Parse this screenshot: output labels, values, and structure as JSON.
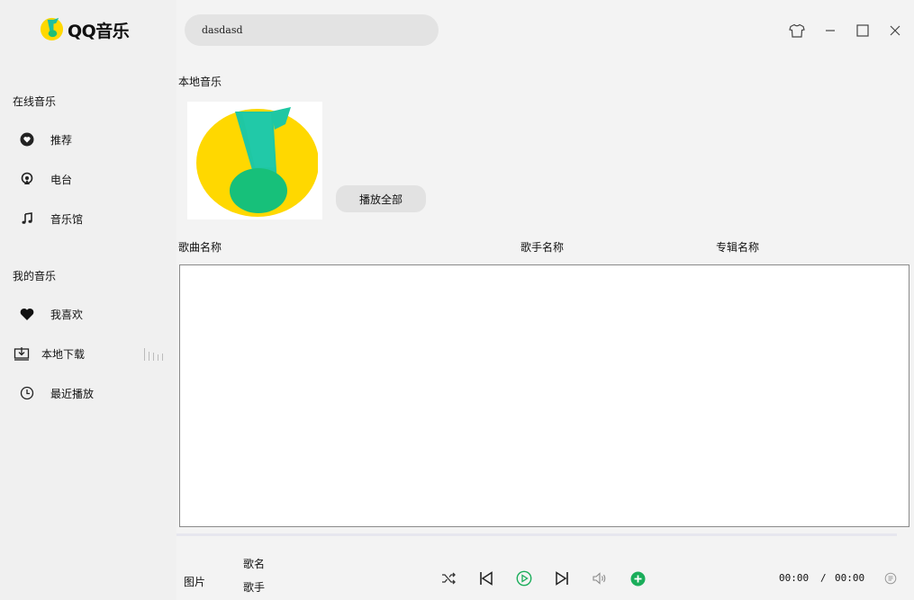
{
  "app": {
    "name": "QQ音乐"
  },
  "sidebar": {
    "online_title": "在线音乐",
    "online_items": [
      {
        "label": "推荐",
        "icon": "heart-circle-icon"
      },
      {
        "label": "电台",
        "icon": "radio-icon"
      },
      {
        "label": "音乐馆",
        "icon": "music-note-icon"
      }
    ],
    "mine_title": "我的音乐",
    "mine_items": [
      {
        "label": "我喜欢",
        "icon": "heart-icon"
      },
      {
        "label": "本地下载",
        "icon": "download-icon"
      },
      {
        "label": "最近播放",
        "icon": "clock-icon"
      }
    ]
  },
  "search": {
    "value": "dasdasd"
  },
  "window_controls": [
    "skin-icon",
    "minimize-icon",
    "maximize-icon",
    "close-icon"
  ],
  "main": {
    "title": "本地音乐",
    "play_all": "播放全部",
    "columns": [
      "歌曲名称",
      "歌手名称",
      "专辑名称"
    ]
  },
  "player": {
    "picture": "图片",
    "song": "歌名",
    "artist": "歌手",
    "current_time": "00:00",
    "separator": "/",
    "total_time": "00:00"
  },
  "colors": {
    "brand_yellow": "#ffd800",
    "brand_green": "#1fbf74",
    "accent_green": "#1aad5a"
  }
}
